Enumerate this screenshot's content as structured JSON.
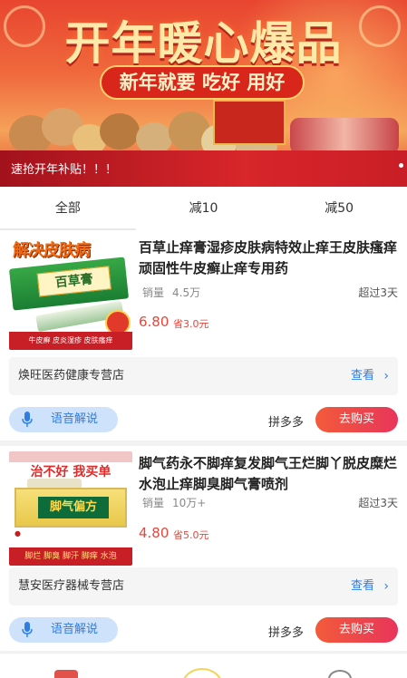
{
  "banner": {
    "title": "开年暖心爆品",
    "slogan": "新年就要 吃好 用好",
    "promo_text": "速抢开年补贴！！！",
    "colors": {
      "primary": "#e8452f",
      "accent": "#ffe9a8"
    }
  },
  "tabs": [
    {
      "label": "全部"
    },
    {
      "label": "减10"
    },
    {
      "label": "减50"
    }
  ],
  "products": [
    {
      "image_headline": "解决皮肤病",
      "image_box_label": "百草膏",
      "image_footer": "牛皮癣 皮炎湿疹 皮肤瘙痒",
      "title": "百草止痒膏湿疹皮肤病特效止痒王皮肤瘙痒顽固性牛皮癣止痒专用药",
      "sales_label": "销量",
      "sales_value": "4.5万",
      "ship_note": "超过3天",
      "price": "6.80",
      "save_text": "省3.0元",
      "shop_name": "焕旺医药健康专营店",
      "view_label": "查看",
      "voice_label": "语音解说",
      "platform": "拼多多",
      "buy_label": "去购买"
    },
    {
      "image_headline": "治不好 我买单",
      "image_box_label": "脚气偏方",
      "image_footer": "脚烂 脚臭 脚汗 脚痒 水泡",
      "title": "脚气药永不脚痒复发脚气王烂脚丫脱皮糜烂水泡止痒脚臭脚气膏喷剂",
      "sales_label": "销量",
      "sales_value": "10万+",
      "ship_note": "超过3天",
      "price": "4.80",
      "save_text": "省5.0元",
      "shop_name": "慧安医疗器械专营店",
      "view_label": "查看",
      "voice_label": "语音解说",
      "platform": "拼多多",
      "buy_label": "去购买"
    }
  ],
  "colors": {
    "price": "#e8453a",
    "link": "#2f7de1",
    "buy_gradient_start": "#f25b3a",
    "buy_gradient_end": "#e8355b",
    "voice_bg": "#cfe2fb"
  }
}
